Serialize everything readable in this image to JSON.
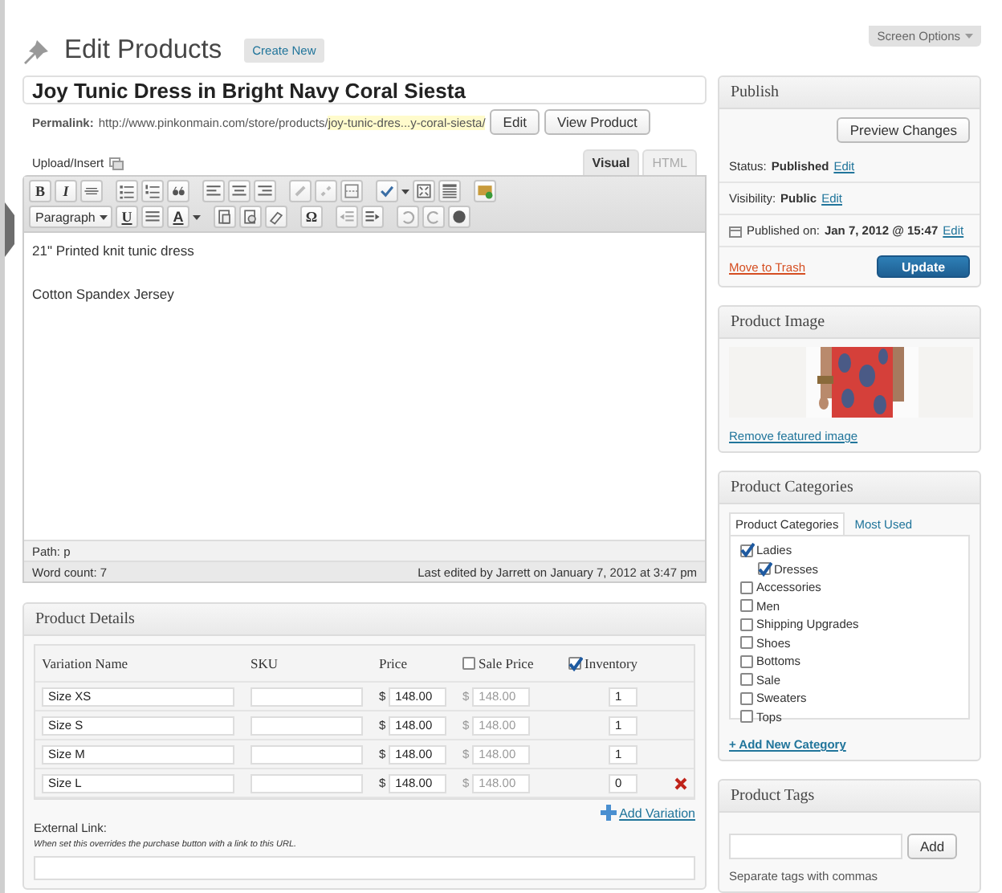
{
  "page": {
    "title": "Edit Products",
    "create_button": "Create New",
    "screen_options": "Screen Options"
  },
  "post": {
    "title": "Joy Tunic Dress in Bright Navy Coral Siesta",
    "permalink_label": "Permalink:",
    "permalink_base": "http://www.pinkonmain.com/store/products/",
    "permalink_slug": "joy-tunic-dres...y-coral-siesta/",
    "edit_button": "Edit",
    "view_button": "View Product"
  },
  "editor": {
    "upload_label": "Upload/Insert",
    "tabs": [
      {
        "label": "Visual",
        "selected": true
      },
      {
        "label": "HTML",
        "selected": false
      }
    ],
    "toolbar": {
      "bold": "B",
      "italic": "I",
      "underline": "U",
      "text_color": "A",
      "special_char": "Ω",
      "format": "Paragraph"
    },
    "paragraphs": [
      "21\" Printed knit tunic dress",
      "Cotton Spandex Jersey"
    ],
    "path": "Path: p",
    "word_count": "Word count: 7",
    "last_edited": "Last edited by Jarrett on January 7, 2012 at 3:47 pm"
  },
  "product_details": {
    "title": "Product Details",
    "columns": [
      {
        "label": "Variation Name",
        "kind": "text"
      },
      {
        "label": "SKU",
        "kind": "text"
      },
      {
        "label": "Price",
        "kind": "text"
      },
      {
        "label": "Sale Price",
        "kind": "checkbox",
        "checked": false
      },
      {
        "label": "Inventory",
        "kind": "checkbox",
        "checked": true
      }
    ],
    "rows": [
      {
        "name": "Size XS",
        "currency": "$",
        "price": "148.00",
        "sale_currency": "$",
        "sale_placeholder": "148.00",
        "inventory": "1",
        "deletable": false
      },
      {
        "name": "Size S",
        "currency": "$",
        "price": "148.00",
        "sale_currency": "$",
        "sale_placeholder": "148.00",
        "inventory": "1",
        "deletable": false
      },
      {
        "name": "Size M",
        "currency": "$",
        "price": "148.00",
        "sale_currency": "$",
        "sale_placeholder": "148.00",
        "inventory": "1",
        "deletable": false
      },
      {
        "name": "Size L",
        "currency": "$",
        "price": "148.00",
        "sale_currency": "$",
        "sale_placeholder": "148.00",
        "inventory": "0",
        "deletable": true
      }
    ],
    "add_variation": "Add Variation",
    "external_link_label": "External Link:",
    "external_link_hint": "When set this overrides the purchase button with a link to this URL."
  },
  "publish": {
    "title": "Publish",
    "preview_button": "Preview Changes",
    "status_label": "Status:",
    "status": "Published",
    "status_edit": "Edit",
    "visibility_label": "Visibility:",
    "visibility": "Public",
    "visibility_edit": "Edit",
    "date_label": "Published on:",
    "date": "Jan 7, 2012 @ 15:47",
    "date_edit": "Edit",
    "trash": "Move to Trash",
    "update": "Update"
  },
  "product_image": {
    "title": "Product Image",
    "remove_link": "Remove featured image"
  },
  "categories": {
    "title": "Product Categories",
    "tabs": [
      {
        "label": "Product Categories",
        "selected": true
      },
      {
        "label": "Most Used",
        "selected": false
      }
    ],
    "items": [
      {
        "label": "Ladies",
        "checked": true,
        "children": [
          {
            "label": "Dresses",
            "checked": true
          }
        ]
      },
      {
        "label": "Accessories",
        "checked": false
      },
      {
        "label": "Men",
        "checked": false
      },
      {
        "label": "Shipping Upgrades",
        "checked": false
      },
      {
        "label": "Shoes",
        "checked": false
      },
      {
        "label": "Bottoms",
        "checked": false
      },
      {
        "label": "Sale",
        "checked": false
      },
      {
        "label": "Sweaters",
        "checked": false
      },
      {
        "label": "Tops",
        "checked": false
      }
    ],
    "add_link": "+ Add New Category"
  },
  "tags": {
    "title": "Product Tags",
    "add_button": "Add",
    "hint": "Separate tags with commas"
  }
}
